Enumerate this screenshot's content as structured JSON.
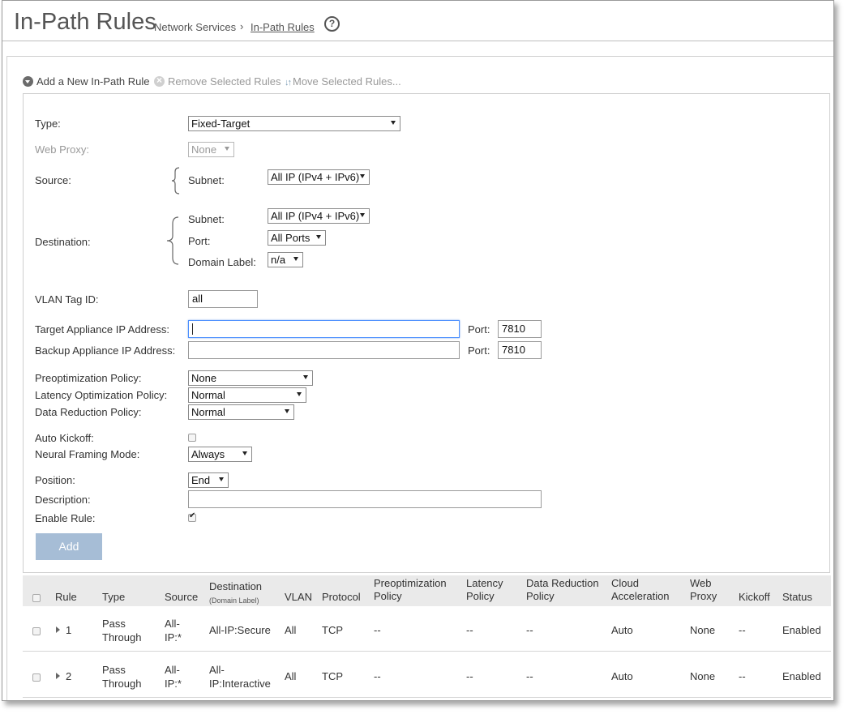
{
  "header": {
    "title": "In-Path Rules",
    "breadcrumb_parent": "Network Services",
    "breadcrumb_sep": "›",
    "breadcrumb_current": "In-Path Rules",
    "help": "?"
  },
  "toolbar": {
    "add": "Add a New In-Path Rule",
    "remove": "Remove Selected Rules",
    "move": "Move Selected Rules..."
  },
  "form": {
    "type_label": "Type:",
    "type_value": "Fixed-Target",
    "web_proxy_label": "Web Proxy:",
    "web_proxy_value": "None",
    "source_label": "Source:",
    "source_subnet_label": "Subnet:",
    "source_subnet_value": "All IP (IPv4 + IPv6)",
    "destination_label": "Destination:",
    "dest_subnet_label": "Subnet:",
    "dest_subnet_value": "All IP (IPv4 + IPv6)",
    "dest_port_label": "Port:",
    "dest_port_value": "All Ports",
    "dest_domain_label": "Domain Label:",
    "dest_domain_value": "n/a",
    "vlan_label": "VLAN Tag ID:",
    "vlan_value": "all",
    "target_label": "Target Appliance IP Address:",
    "target_value": "",
    "target_port_label": "Port:",
    "target_port_value": "7810",
    "backup_label": "Backup Appliance IP Address:",
    "backup_value": "",
    "backup_port_label": "Port:",
    "backup_port_value": "7810",
    "preopt_label": "Preoptimization Policy:",
    "preopt_value": "None",
    "latency_label": "Latency Optimization Policy:",
    "latency_value": "Normal",
    "datared_label": "Data Reduction Policy:",
    "datared_value": "Normal",
    "autokick_label": "Auto Kickoff:",
    "autokick_checked": false,
    "neural_label": "Neural Framing Mode:",
    "neural_value": "Always",
    "position_label": "Position:",
    "position_value": "End",
    "description_label": "Description:",
    "description_value": "",
    "enable_label": "Enable Rule:",
    "enable_checked": true,
    "add_button": "Add"
  },
  "table": {
    "columns": {
      "rule": "Rule",
      "type": "Type",
      "source": "Source",
      "destination": "Destination",
      "domain_label": "(Domain Label)",
      "vlan": "VLAN",
      "protocol": "Protocol",
      "preopt_1": "Preoptimization",
      "preopt_2": "Policy",
      "latency_1": "Latency",
      "latency_2": "Policy",
      "datared_1": "Data Reduction",
      "datared_2": "Policy",
      "cloud_1": "Cloud",
      "cloud_2": "Acceleration",
      "webproxy_1": "Web",
      "webproxy_2": "Proxy",
      "kickoff": "Kickoff",
      "status": "Status"
    },
    "rows": [
      {
        "rule": "1",
        "type_1": "Pass",
        "type_2": "Through",
        "source_1": "All-",
        "source_2": "IP:*",
        "dest_1": "All-IP:Secure",
        "dest_2": "",
        "vlan": "All",
        "protocol": "TCP",
        "preopt": "--",
        "latency": "--",
        "datared": "--",
        "cloud": "Auto",
        "webproxy": "None",
        "kickoff": "--",
        "status": "Enabled"
      },
      {
        "rule": "2",
        "type_1": "Pass",
        "type_2": "Through",
        "source_1": "All-",
        "source_2": "IP:*",
        "dest_1": "All-",
        "dest_2": "IP:Interactive",
        "vlan": "All",
        "protocol": "TCP",
        "preopt": "--",
        "latency": "--",
        "datared": "--",
        "cloud": "Auto",
        "webproxy": "None",
        "kickoff": "--",
        "status": "Enabled"
      }
    ]
  }
}
